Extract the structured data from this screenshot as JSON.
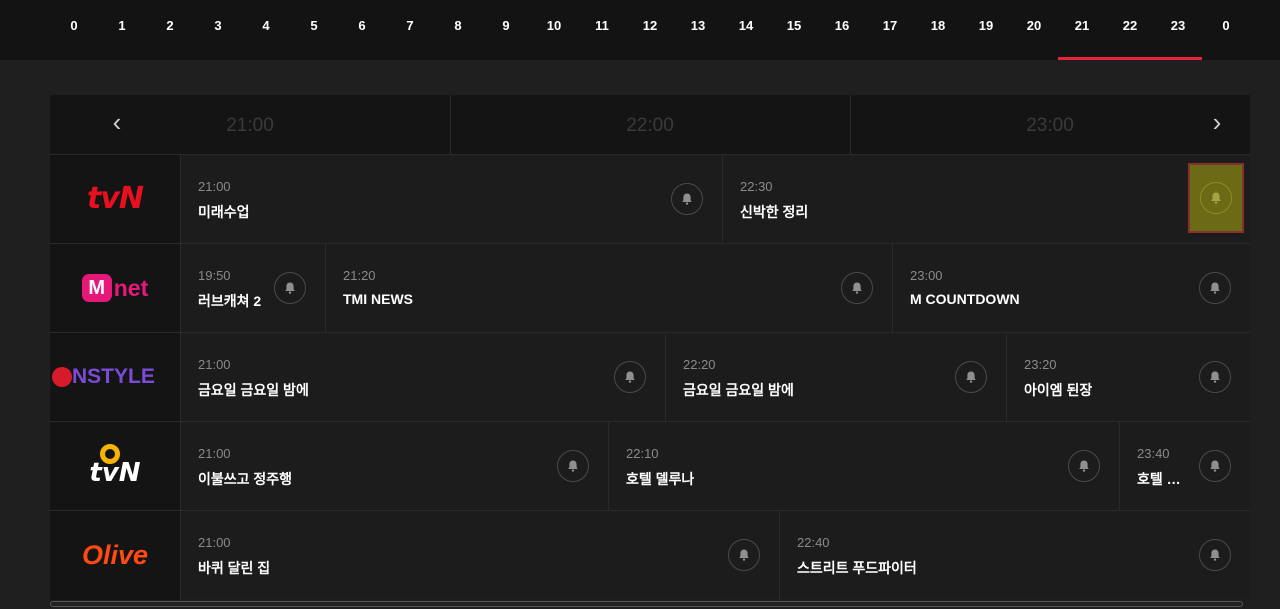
{
  "hour_bar": {
    "hours": [
      "0",
      "1",
      "2",
      "3",
      "4",
      "5",
      "6",
      "7",
      "8",
      "9",
      "10",
      "11",
      "12",
      "13",
      "14",
      "15",
      "16",
      "17",
      "18",
      "19",
      "20",
      "21",
      "22",
      "23",
      "0"
    ],
    "active_index": 21,
    "active_color": "#e8253c"
  },
  "timeline": {
    "prev_icon": "chevron-left-icon",
    "next_icon": "chevron-right-icon",
    "prev_glyph": "‹",
    "next_glyph": "›",
    "slots": [
      "21:00",
      "22:00",
      "23:00"
    ]
  },
  "channels": [
    {
      "name": "tvN",
      "logo_text": "tvN",
      "programs": [
        {
          "time": "21:00",
          "title": "미래수업"
        },
        {
          "time": "22:30",
          "title": "신박한 정리"
        }
      ]
    },
    {
      "name": "Mnet",
      "logo_text": "net",
      "logo_mark": "M",
      "programs": [
        {
          "time": "19:50",
          "title": "러브캐쳐 2"
        },
        {
          "time": "21:20",
          "title": "TMI NEWS"
        },
        {
          "time": "23:00",
          "title": "M COUNTDOWN"
        }
      ]
    },
    {
      "name": "OnStyle",
      "logo_text": "NSTYLE",
      "programs": [
        {
          "time": "21:00",
          "title": "금요일 금요일 밤에"
        },
        {
          "time": "22:20",
          "title": "금요일 금요일 밤에"
        },
        {
          "time": "23:20",
          "title": "아이엠 된장"
        }
      ]
    },
    {
      "name": "O tvN",
      "logo_text": "tvN",
      "programs": [
        {
          "time": "21:00",
          "title": "이불쓰고 정주행"
        },
        {
          "time": "22:10",
          "title": "호텔 델루나"
        },
        {
          "time": "23:40",
          "title": "호텔 …"
        }
      ]
    },
    {
      "name": "Olive",
      "logo_text": "Olive",
      "programs": [
        {
          "time": "21:00",
          "title": "바퀴 달린 집"
        },
        {
          "time": "22:40",
          "title": "스트리트 푸드파이터"
        }
      ]
    }
  ],
  "colors": {
    "tvn_red": "#e8101e",
    "mnet_pink": "#e6197b",
    "onstyle_purple": "#7b4bd6",
    "onstyle_red": "#d81b2a",
    "olive_orange": "#ff4a12",
    "otvn_yellow": "#f5b400"
  },
  "bell_icon": "bell-icon"
}
